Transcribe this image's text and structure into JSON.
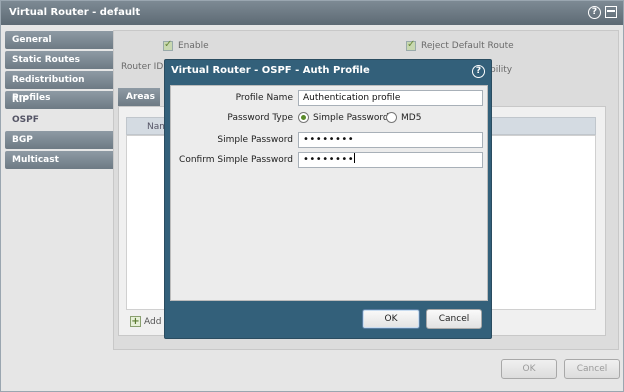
{
  "window": {
    "title": "Virtual Router - default"
  },
  "sidebar": {
    "items": [
      {
        "label": "General"
      },
      {
        "label": "Static Routes"
      },
      {
        "label": "Redistribution Profiles"
      },
      {
        "label": "RIP"
      },
      {
        "label": "OSPF"
      },
      {
        "label": "BGP"
      },
      {
        "label": "Multicast"
      }
    ],
    "active": "OSPF"
  },
  "ospf": {
    "enable_label": "Enable",
    "reject_default_route_label": "Reject Default Route",
    "router_id_label": "Router ID",
    "partial_label": "bility",
    "areas_tab": "Areas",
    "table_header_name": "Nam",
    "add_label": "Add"
  },
  "dialog": {
    "title": "Virtual Router - OSPF - Auth Profile",
    "profile_name_label": "Profile Name",
    "profile_name_value": "Authentication profile",
    "password_type_label": "Password Type",
    "option_simple": "Simple Password",
    "option_md5": "MD5",
    "selected_option": "Simple Password",
    "simple_password_label": "Simple Password",
    "simple_password_value": "••••••••",
    "confirm_password_label": "Confirm Simple Password",
    "confirm_password_value": "••••••••",
    "ok_label": "OK",
    "cancel_label": "Cancel"
  },
  "footer": {
    "ok_label": "OK",
    "cancel_label": "Cancel"
  }
}
